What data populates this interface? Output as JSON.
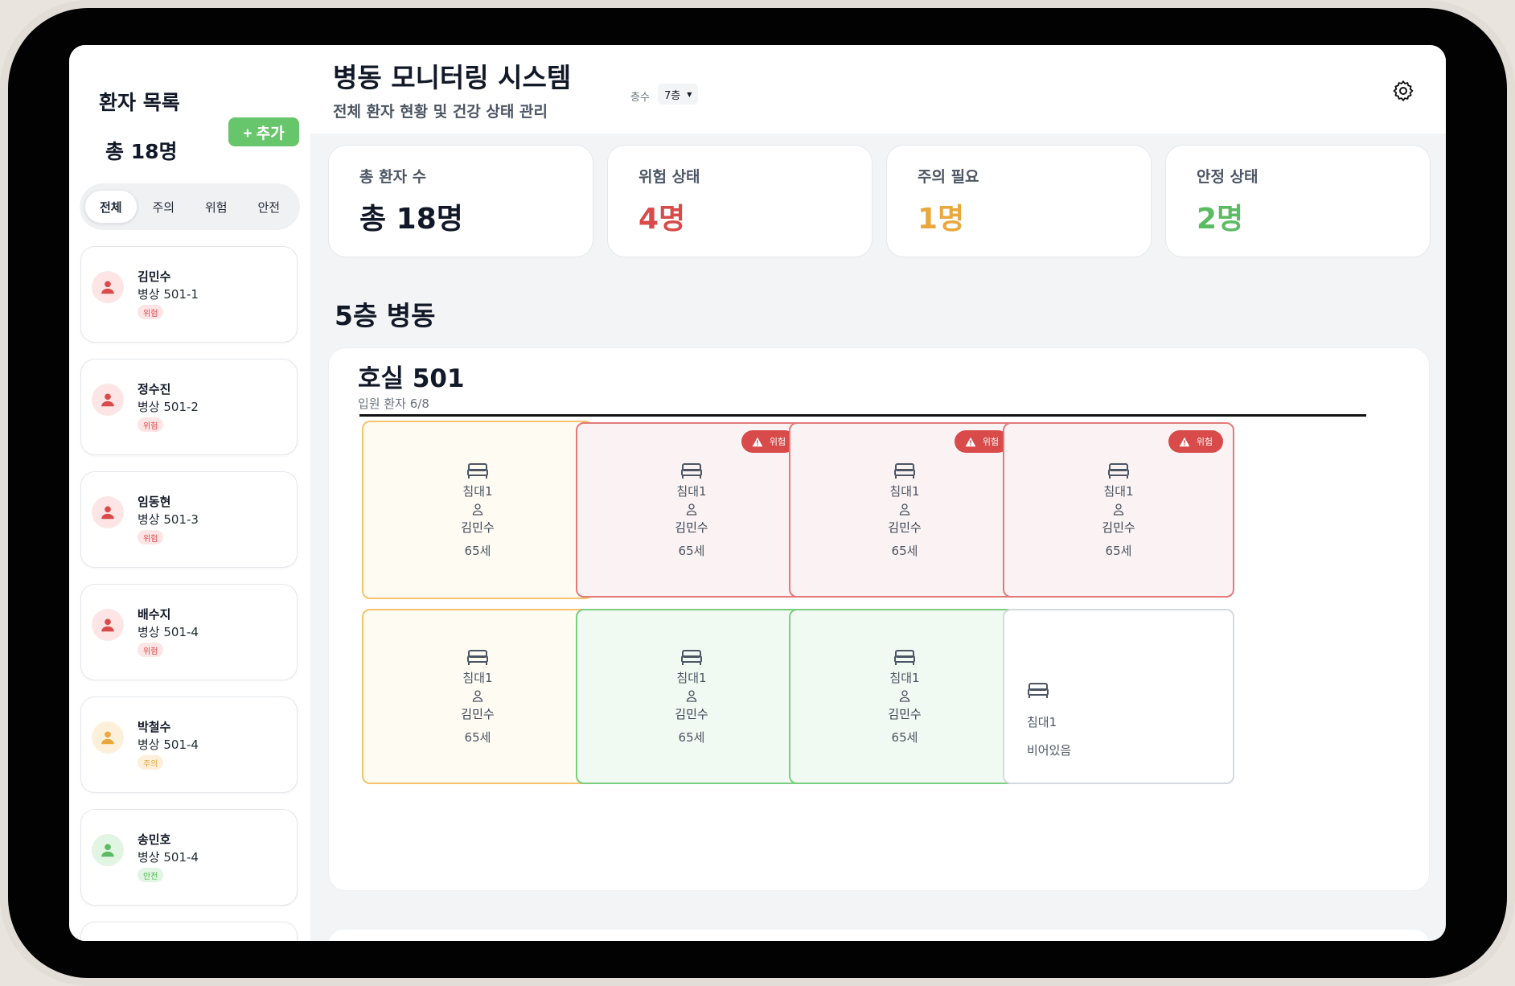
{
  "sidebar": {
    "title": "환자 목록",
    "total": "총 18명",
    "add_label": "+ 추가",
    "filters": [
      "전체",
      "주의",
      "위험",
      "안전"
    ],
    "patients": [
      {
        "name": "김민수",
        "bed": "병상 501-1",
        "status": "위험"
      },
      {
        "name": "정수진",
        "bed": "병상 501-2",
        "status": "위험"
      },
      {
        "name": "임동현",
        "bed": "병상 501-3",
        "status": "위험"
      },
      {
        "name": "배수지",
        "bed": "병상 501-4",
        "status": "위험"
      },
      {
        "name": "박철수",
        "bed": "병상 501-4",
        "status": "주의"
      },
      {
        "name": "송민호",
        "bed": "병상 501-4",
        "status": "안전"
      }
    ]
  },
  "header": {
    "title": "병동 모니터링 시스템",
    "subtitle": "전체 환자 현황 및 건강 상태 관리",
    "floor_label": "층수",
    "floor_value": "7층"
  },
  "stats": [
    {
      "label": "총 환자 수",
      "value": "총 18명",
      "color": "#111827"
    },
    {
      "label": "위험 상태",
      "value": "4명",
      "color": "#d94a4a"
    },
    {
      "label": "주의 필요",
      "value": "1명",
      "color": "#e9a73c"
    },
    {
      "label": "안정 상태",
      "value": "2명",
      "color": "#5bbb62"
    }
  ],
  "ward": {
    "title": "5층 병동",
    "room_title": "호실 501",
    "room_sub": "입원 환자 6/8",
    "alert_label": "위험",
    "empty_label": "비어있음",
    "beds": [
      {
        "name": "침대1",
        "patient": "김민수",
        "age": "65세",
        "status": "warning"
      },
      {
        "name": "침대1",
        "patient": "김민수",
        "age": "65세",
        "status": "danger"
      },
      {
        "name": "침대1",
        "patient": "김민수",
        "age": "65세",
        "status": "danger"
      },
      {
        "name": "침대1",
        "patient": "김민수",
        "age": "65세",
        "status": "danger"
      },
      {
        "name": "침대1",
        "patient": "김민수",
        "age": "65세",
        "status": "warning"
      },
      {
        "name": "침대1",
        "patient": "김민수",
        "age": "65세",
        "status": "safe"
      },
      {
        "name": "침대1",
        "patient": "김민수",
        "age": "65세",
        "status": "safe"
      },
      {
        "name": "침대1",
        "patient": "",
        "age": "",
        "status": "empty"
      }
    ]
  },
  "colors": {
    "danger": "#d94a4a",
    "warning": "#e9a73c",
    "safe": "#5bbb62",
    "add_button": "#67c56b"
  }
}
